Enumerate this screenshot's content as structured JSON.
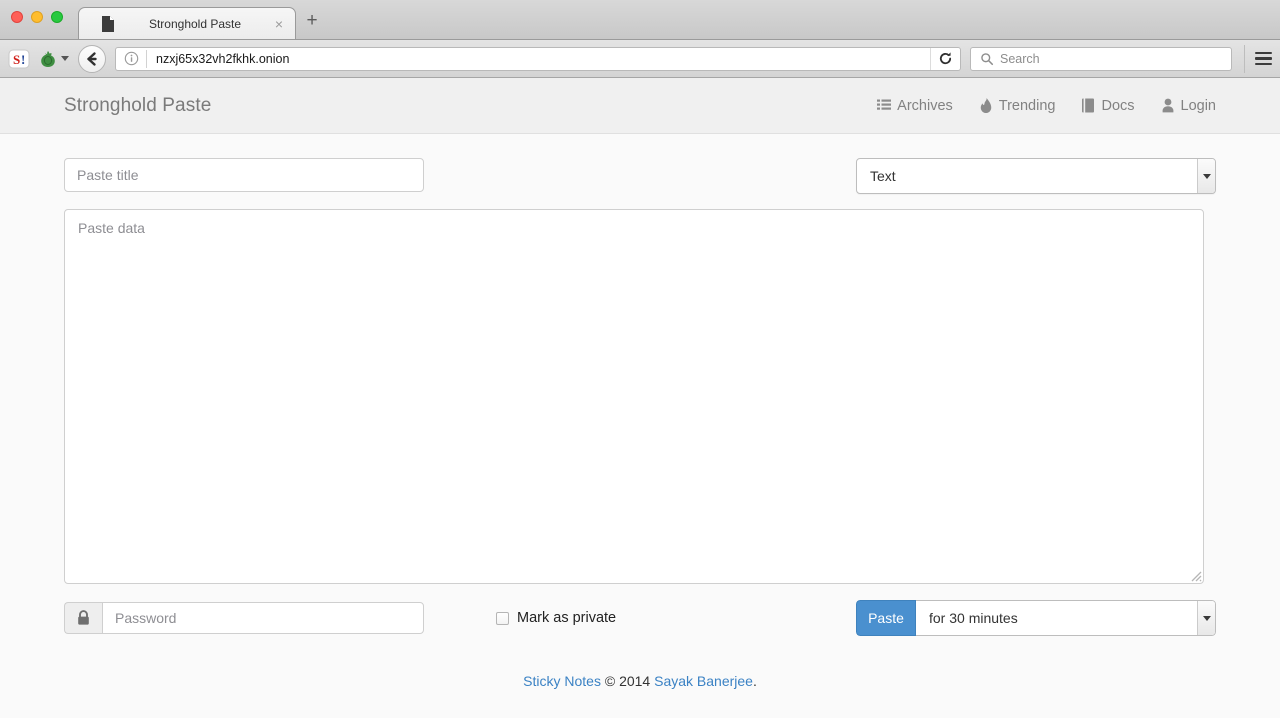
{
  "browser": {
    "tab": {
      "title": "Stronghold Paste",
      "favicon": "page-icon",
      "close": "×"
    },
    "new_tab_label": "+",
    "extensions": [
      {
        "name": "s-badge-icon"
      },
      {
        "name": "tor-onion-icon"
      }
    ],
    "back_label": "back-arrow",
    "url": "nzxj65x32vh2fkhk.onion",
    "info_icon": "info-icon",
    "reload_icon": "reload-icon",
    "search": {
      "placeholder": "Search",
      "icon": "search-icon"
    },
    "menu_icon": "hamburger-menu-icon"
  },
  "site": {
    "brand": "Stronghold Paste",
    "nav": [
      {
        "label": "Archives",
        "icon": "list-icon"
      },
      {
        "label": "Trending",
        "icon": "fire-icon"
      },
      {
        "label": "Docs",
        "icon": "book-icon"
      },
      {
        "label": "Login",
        "icon": "user-icon"
      }
    ]
  },
  "form": {
    "title_placeholder": "Paste title",
    "title_value": "",
    "format_select": {
      "value": "Text",
      "options": [
        "Text"
      ]
    },
    "data_placeholder": "Paste data",
    "data_value": "",
    "password_placeholder": "Password",
    "password_value": "",
    "password_icon": "lock-icon",
    "private_label": "Mark as private",
    "private_checked": false,
    "paste_button": "Paste",
    "duration_select": {
      "value": "for 30 minutes",
      "options": [
        "for 30 minutes"
      ]
    }
  },
  "footer": {
    "app_link": "Sticky Notes",
    "copyright": " © 2014 ",
    "author_link": "Sayak Banerjee",
    "period": "."
  },
  "colors": {
    "primary": "#4a90cf",
    "link": "#3b82c4",
    "header_bg": "#f0f0f0",
    "page_bg": "#fafafa",
    "muted_text": "#8e8e93"
  }
}
